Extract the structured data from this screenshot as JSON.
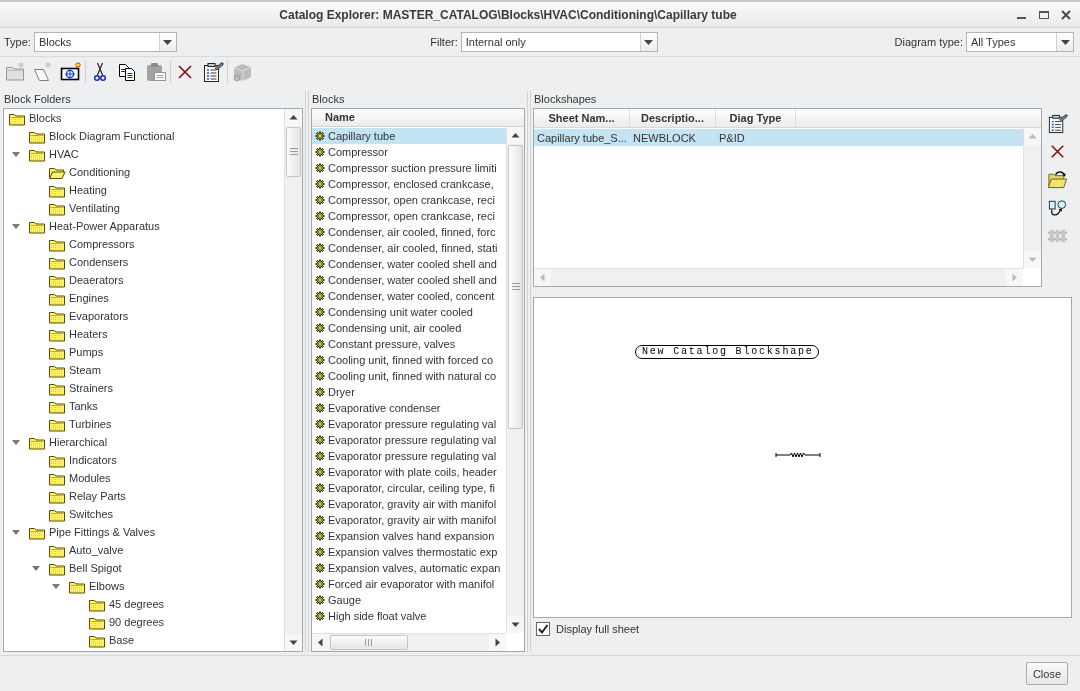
{
  "window": {
    "title": "Catalog Explorer: MASTER_CATALOG\\Blocks\\HVAC\\Conditioning\\Capillary tube"
  },
  "filters": [
    {
      "label": "Type:",
      "value": "Blocks"
    },
    {
      "label": "Filter:",
      "value": "Internal only"
    },
    {
      "label": "Diagram type:",
      "value": "All Types"
    }
  ],
  "toolbar": [
    [
      {
        "kind": "folder",
        "disabled": true
      },
      {
        "kind": "shape",
        "disabled": true
      },
      {
        "kind": "crosshair",
        "disabled": false
      }
    ],
    [
      {
        "kind": "cut",
        "disabled": false
      },
      {
        "kind": "copy",
        "disabled": false
      },
      {
        "kind": "paste",
        "disabled": true
      }
    ],
    [
      {
        "kind": "delete",
        "disabled": false
      },
      {
        "kind": "properties",
        "disabled": false
      }
    ],
    [
      {
        "kind": "cube",
        "disabled": true
      }
    ]
  ],
  "block_folders": {
    "title": "Block Folders",
    "items": [
      {
        "name": "Blocks",
        "selected": false,
        "children": [
          {
            "name": "Block Diagram Functional",
            "selected": false
          },
          {
            "name": "HVAC",
            "selected": false,
            "expanded": true,
            "children": [
              {
                "name": "Conditioning",
                "selected": true
              },
              {
                "name": "Heating",
                "selected": false
              },
              {
                "name": "Ventilating",
                "selected": false
              }
            ]
          },
          {
            "name": "Heat-Power Apparatus",
            "selected": false,
            "expanded": true,
            "children": [
              {
                "name": "Compressors",
                "selected": false
              },
              {
                "name": "Condensers",
                "selected": false
              },
              {
                "name": "Deaerators",
                "selected": false
              },
              {
                "name": "Engines",
                "selected": false
              },
              {
                "name": "Evaporators",
                "selected": false
              },
              {
                "name": "Heaters",
                "selected": false
              },
              {
                "name": "Pumps",
                "selected": false
              },
              {
                "name": "Steam",
                "selected": false
              },
              {
                "name": "Strainers",
                "selected": false
              },
              {
                "name": "Tanks",
                "selected": false
              },
              {
                "name": "Turbines",
                "selected": false
              }
            ]
          },
          {
            "name": "Hierarchical",
            "selected": false,
            "expanded": true,
            "children": [
              {
                "name": "Indicators",
                "selected": false
              },
              {
                "name": "Modules",
                "selected": false
              },
              {
                "name": "Relay Parts",
                "selected": false
              },
              {
                "name": "Switches",
                "selected": false
              }
            ]
          },
          {
            "name": "Pipe Fittings & Valves",
            "selected": false,
            "expanded": true,
            "children": [
              {
                "name": "Auto_valve",
                "selected": false
              },
              {
                "name": "Bell Spigot",
                "selected": false,
                "expanded": true,
                "children": [
                  {
                    "name": "Elbows",
                    "selected": false,
                    "expanded": true,
                    "children": [
                      {
                        "name": "45 degrees",
                        "selected": false
                      },
                      {
                        "name": "90 degrees",
                        "selected": false
                      },
                      {
                        "name": "Base",
                        "selected": false
                      }
                    ]
                  }
                ]
              }
            ]
          }
        ]
      }
    ]
  },
  "blocks": {
    "title": "Blocks",
    "column": "Name",
    "items": [
      {
        "name": "Capillary tube",
        "selected": true
      },
      {
        "name": "Compressor",
        "selected": false
      },
      {
        "name": "Compressor suction pressure limiti",
        "selected": false
      },
      {
        "name": "Compressor, enclosed crankcase,",
        "selected": false
      },
      {
        "name": "Compressor, open crankcase, reci",
        "selected": false
      },
      {
        "name": "Compressor, open crankcase, reci",
        "selected": false
      },
      {
        "name": "Condenser, air cooled, finned, forc",
        "selected": false
      },
      {
        "name": "Condenser, air cooled, finned, stati",
        "selected": false
      },
      {
        "name": "Condenser, water cooled shell and",
        "selected": false
      },
      {
        "name": "Condenser, water cooled shell and",
        "selected": false
      },
      {
        "name": "Condenser, water cooled, concent",
        "selected": false
      },
      {
        "name": "Condensing unit water cooled",
        "selected": false
      },
      {
        "name": "Condensing unit, air cooled",
        "selected": false
      },
      {
        "name": "Constant pressure, valves",
        "selected": false
      },
      {
        "name": "Cooling unit, finned with forced co",
        "selected": false
      },
      {
        "name": "Cooling unit, finned with natural co",
        "selected": false
      },
      {
        "name": "Dryer",
        "selected": false
      },
      {
        "name": "Evaporative condenser",
        "selected": false
      },
      {
        "name": "Evaporator pressure regulating val",
        "selected": false
      },
      {
        "name": "Evaporator pressure regulating val",
        "selected": false
      },
      {
        "name": "Evaporator pressure regulating val",
        "selected": false
      },
      {
        "name": "Evaporator with plate coils, header",
        "selected": false
      },
      {
        "name": "Evaporator, circular, ceiling type, fi",
        "selected": false
      },
      {
        "name": "Evaporator, gravity air with manifol",
        "selected": false
      },
      {
        "name": "Evaporator, gravity air with manifol",
        "selected": false
      },
      {
        "name": "Expansion valves hand expansion",
        "selected": false
      },
      {
        "name": "Expansion valves thermostatic exp",
        "selected": false
      },
      {
        "name": "Expansion valves, automatic expan",
        "selected": false
      },
      {
        "name": "Forced air evaporator with manifol",
        "selected": false
      },
      {
        "name": "Gauge",
        "selected": false
      },
      {
        "name": "High side float valve",
        "selected": false
      }
    ]
  },
  "blockshapes": {
    "title": "Blockshapes",
    "columns": [
      "Sheet Nam...",
      "Descriptio...",
      "Diag Type"
    ],
    "rows": [
      {
        "cells": [
          "Capillary tube_S...",
          "NEWBLOCK",
          "P&ID"
        ],
        "selected": true
      }
    ],
    "tools": [
      {
        "kind": "properties",
        "disabled": false
      },
      {
        "kind": "delete",
        "disabled": false
      },
      {
        "kind": "open",
        "disabled": false
      },
      {
        "kind": "swap",
        "disabled": false
      },
      {
        "kind": "connector",
        "disabled": true
      }
    ],
    "preview": {
      "label": "New Catalog Blockshape"
    },
    "display_full_sheet": {
      "label": "Display full sheet",
      "checked": true
    }
  },
  "footer": {
    "buttons": [
      "Close"
    ]
  }
}
